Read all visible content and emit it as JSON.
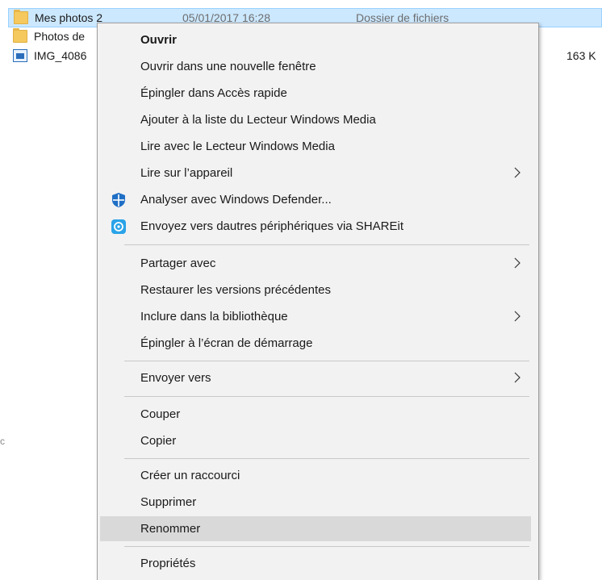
{
  "files": [
    {
      "name": "Mes photos 2",
      "date": "05/01/2017 16:28",
      "type": "Dossier de fichiers",
      "size": "",
      "icon": "folder-icon",
      "selected": true
    },
    {
      "name": "Photos de",
      "date": "",
      "type": "",
      "size": "",
      "icon": "folder-icon",
      "selected": false
    },
    {
      "name": "IMG_4086",
      "date": "",
      "type": "",
      "size": "163 K",
      "icon": "image-file-icon",
      "selected": false
    }
  ],
  "edge_mark": "c",
  "menu": {
    "items": [
      {
        "label": "Ouvrir",
        "bold": true
      },
      {
        "label": "Ouvrir dans une nouvelle fenêtre"
      },
      {
        "label": "Épingler dans Accès rapide"
      },
      {
        "label": "Ajouter à la liste du Lecteur Windows Media"
      },
      {
        "label": "Lire avec le Lecteur Windows Media"
      },
      {
        "label": "Lire sur l’appareil",
        "submenu": true
      },
      {
        "label": "Analyser avec Windows Defender...",
        "icon": "windows-defender-icon"
      },
      {
        "label": "Envoyez vers dautres périphériques via SHAREit",
        "icon": "shareit-icon"
      },
      {
        "label": "Partager avec",
        "submenu": true
      },
      {
        "label": "Restaurer les versions précédentes"
      },
      {
        "label": "Inclure dans la bibliothèque",
        "submenu": true
      },
      {
        "label": "Épingler à l’écran de démarrage"
      },
      {
        "label": "Envoyer vers",
        "submenu": true
      },
      {
        "label": "Couper"
      },
      {
        "label": "Copier"
      },
      {
        "label": "Créer un raccourci"
      },
      {
        "label": "Supprimer"
      },
      {
        "label": "Renommer",
        "highlighted": true
      },
      {
        "label": "Propriétés"
      }
    ]
  },
  "colors": {
    "selection": "#cce8ff",
    "menu_background": "#f2f2f2",
    "menu_highlight": "#d9d9d9",
    "defender_blue": "#1f6fc5",
    "shareit_blue": "#2aa3e8"
  }
}
